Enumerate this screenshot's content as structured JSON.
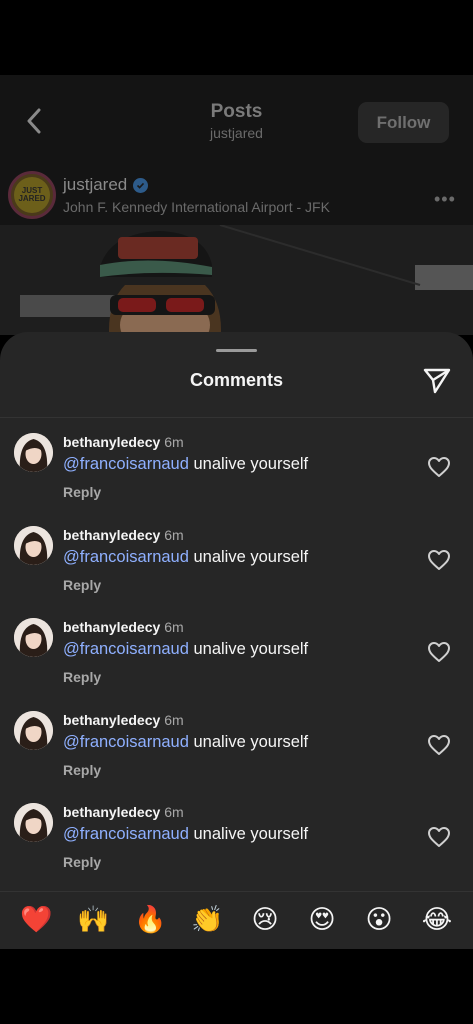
{
  "header": {
    "title": "Posts",
    "subtitle": "justjared",
    "follow_label": "Follow"
  },
  "post": {
    "username": "justjared",
    "location": "John F. Kennedy International Airport - JFK",
    "avatar_text": "JUST JARED"
  },
  "comments_sheet": {
    "title": "Comments",
    "comments": [
      {
        "username": "bethanyledecy",
        "time": "6m",
        "mention": "@francoisarnaud",
        "text": " unalive yourself",
        "reply_label": "Reply"
      },
      {
        "username": "bethanyledecy",
        "time": "6m",
        "mention": "@francoisarnaud",
        "text": " unalive yourself",
        "reply_label": "Reply"
      },
      {
        "username": "bethanyledecy",
        "time": "6m",
        "mention": "@francoisarnaud",
        "text": " unalive yourself",
        "reply_label": "Reply"
      },
      {
        "username": "bethanyledecy",
        "time": "6m",
        "mention": "@francoisarnaud",
        "text": " unalive yourself",
        "reply_label": "Reply"
      },
      {
        "username": "bethanyledecy",
        "time": "6m",
        "mention": "@francoisarnaud",
        "text": " unalive yourself",
        "reply_label": "Reply"
      }
    ],
    "emojis": [
      "❤️",
      "🙌",
      "🔥",
      "👏",
      "😢",
      "😍",
      "😮",
      "😂"
    ]
  },
  "colors": {
    "background": "#000000",
    "sheet": "#262626",
    "mention": "#8fb0ff",
    "secondary_text": "#a8a8a8"
  }
}
